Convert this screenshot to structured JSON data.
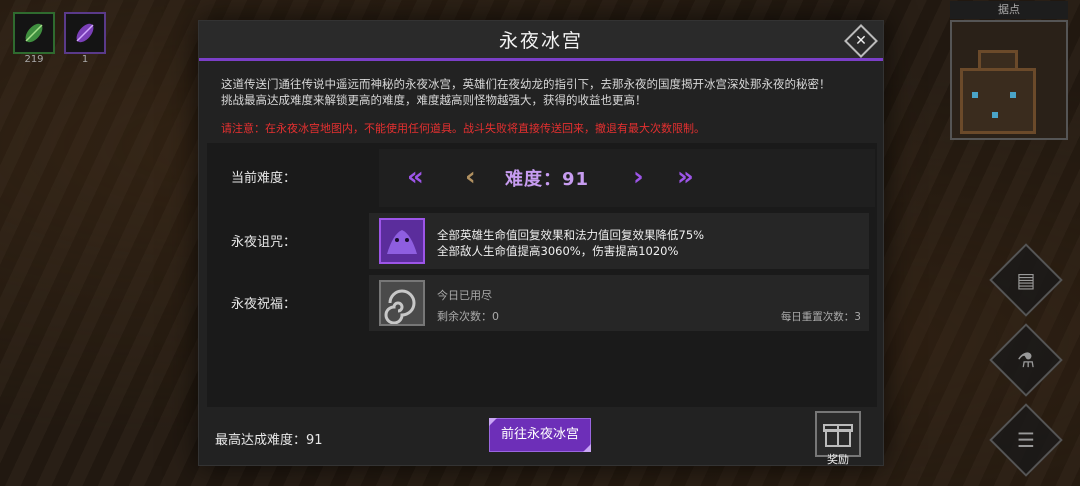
{
  "hud": {
    "slots": [
      {
        "icon": "leaf-gem-icon",
        "count": "219"
      },
      {
        "icon": "purple-gem-icon",
        "count": "1"
      }
    ],
    "minimap_label": "据点"
  },
  "dialog": {
    "title": "永夜冰宫",
    "description_1": "这道传送门通往传说中遥远而神秘的永夜冰宫，英雄们在夜幼龙的指引下，去那永夜的国度揭开冰宫深处那永夜的秘密！",
    "description_2": "挑战最高达成难度来解锁更高的难度，难度越高则怪物越强大，获得的收益也更高！",
    "warning": "请注意：在永夜冰宫地图内，不能使用任何道具。战斗失败将直接传送回来，撤退有最大次数限制。",
    "difficulty": {
      "label": "当前难度：",
      "value_text": "难度：91",
      "value": 91
    },
    "curse": {
      "label": "永夜诅咒：",
      "effect_1": "全部英雄生命值回复效果和法力值回复效果降低75%",
      "effect_2": "全部敌人生命值提高3060%，伤害提高1020%"
    },
    "blessing": {
      "label": "永夜祝福：",
      "status": "今日已用尽",
      "remaining": "剩余次数：0",
      "daily_reset": "每日重置次数：3"
    },
    "max_difficulty": "最高达成难度：91",
    "go_button": "前往永夜冰宫",
    "reward_label": "奖励"
  },
  "colors": {
    "accent": "#7b3fc8",
    "warning": "#e53030",
    "difficulty_text": "#c79cf0"
  }
}
